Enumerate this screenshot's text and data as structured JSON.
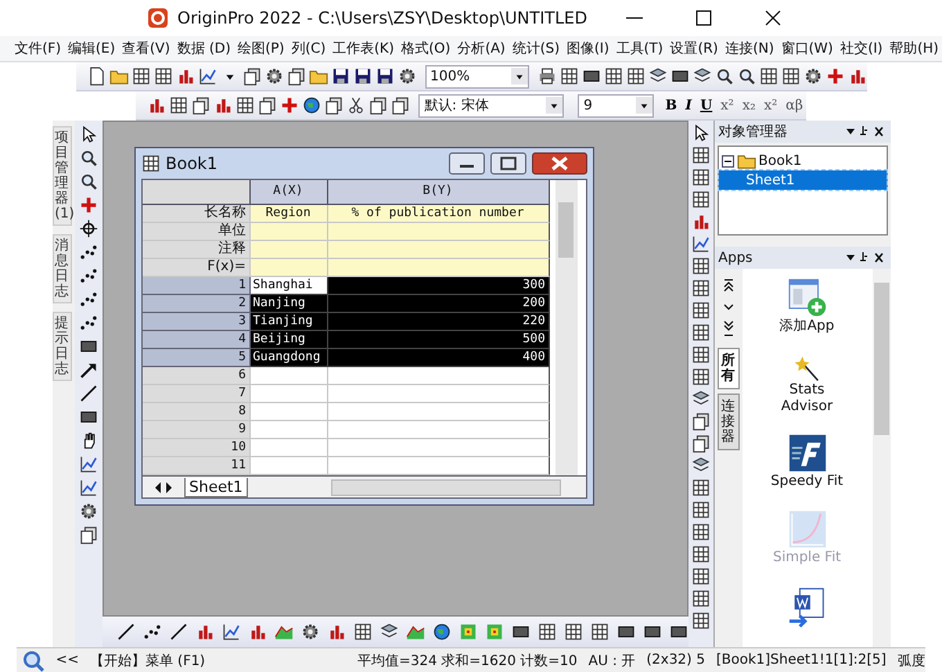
{
  "window": {
    "title": "OriginPro 2022 - C:\\Users\\ZSY\\Desktop\\UNTITLED"
  },
  "menu": [
    "文件(F)",
    "编辑(E)",
    "查看(V)",
    "数据 (D)",
    "绘图(P)",
    "列(C)",
    "工作表(K)",
    "格式(O)",
    "分析(A)",
    "统计(S)",
    "图像(I)",
    "工具(T)",
    "设置(R)",
    "连接(N)",
    "窗口(W)",
    "社交(I)",
    "帮助(H)"
  ],
  "toolbar": {
    "zoom": "100%",
    "font": "默认: 宋体",
    "font_size": "9",
    "format_buttons": [
      "B",
      "I",
      "U",
      "x²",
      "x₂",
      "x²",
      "αβ"
    ]
  },
  "left_tabs": [
    "项目管理器 (1)",
    "消息日志",
    "提示日志"
  ],
  "workbook": {
    "title": "Book1",
    "columns": [
      "A(X)",
      "B(Y)"
    ],
    "label_rows": [
      {
        "label": "长名称",
        "values": [
          "Region",
          "% of publication number"
        ]
      },
      {
        "label": "单位",
        "values": []
      },
      {
        "label": "注释",
        "values": []
      },
      {
        "label": "F(x)=",
        "values": []
      }
    ],
    "rows": [
      {
        "index": "1",
        "selected": true,
        "cells": [
          {
            "text": "Shanghai",
            "active": true
          },
          {
            "text": "300",
            "active": false
          }
        ]
      },
      {
        "index": "2",
        "selected": true,
        "cells": [
          {
            "text": "Nanjing",
            "active": false
          },
          {
            "text": "200",
            "active": false
          }
        ]
      },
      {
        "index": "3",
        "selected": true,
        "cells": [
          {
            "text": "Tianjing",
            "active": false
          },
          {
            "text": "220",
            "active": false
          }
        ]
      },
      {
        "index": "4",
        "selected": true,
        "cells": [
          {
            "text": "Beijing",
            "active": false
          },
          {
            "text": "500",
            "active": false
          }
        ]
      },
      {
        "index": "5",
        "selected": true,
        "cells": [
          {
            "text": "Guangdong",
            "active": false
          },
          {
            "text": "400",
            "active": false
          }
        ]
      },
      {
        "index": "6",
        "selected": false,
        "cells": []
      },
      {
        "index": "7",
        "selected": false,
        "cells": []
      },
      {
        "index": "8",
        "selected": false,
        "cells": []
      },
      {
        "index": "9",
        "selected": false,
        "cells": []
      },
      {
        "index": "10",
        "selected": false,
        "cells": []
      },
      {
        "index": "11",
        "selected": false,
        "cells": []
      }
    ],
    "sheet_tab": "Sheet1"
  },
  "object_manager": {
    "title": "对象管理器",
    "tree": [
      {
        "label": "Book1",
        "expanded": true,
        "selected": false,
        "children": [
          {
            "label": "Sheet1",
            "selected": true
          }
        ]
      }
    ]
  },
  "apps": {
    "title": "Apps",
    "tabs": [
      {
        "label": "所有",
        "selected": true
      },
      {
        "label": "连接器",
        "selected": false
      }
    ],
    "items": [
      {
        "kind": "add",
        "label": "添加App",
        "disabled": false
      },
      {
        "kind": "wand",
        "label": "Stats Advisor",
        "disabled": false
      },
      {
        "kind": "speedy",
        "label": "Speedy Fit",
        "disabled": false
      },
      {
        "kind": "curve",
        "label": "Simple Fit",
        "disabled": true
      },
      {
        "kind": "word",
        "disabled": false
      }
    ]
  },
  "status_bar": {
    "collapse": "<<",
    "hint": "【开始】菜单 (F1)",
    "stats": "平均值=324 求和=1620 计数=10",
    "au": "AU : 开",
    "size": "(2x32) 5",
    "range": "[Book1]Sheet1!1[1]:2[5]",
    "angle": "弧度"
  }
}
